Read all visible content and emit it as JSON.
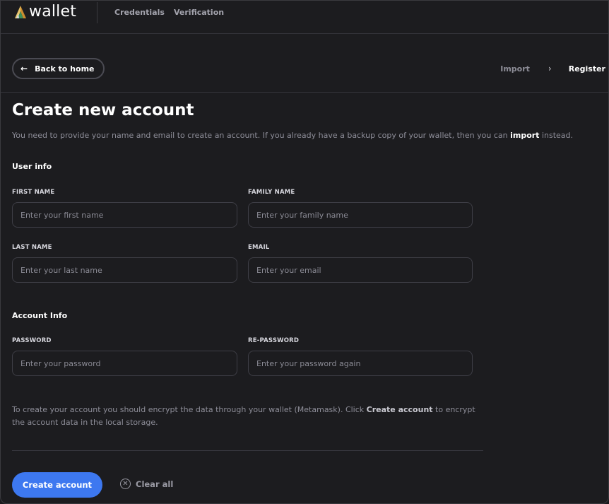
{
  "header": {
    "logo_text": "wallet",
    "nav": [
      {
        "label": "Credentials"
      },
      {
        "label": "Verification"
      }
    ]
  },
  "subbar": {
    "back_label": "Back to home",
    "steps": {
      "import": "Import",
      "register": "Register"
    }
  },
  "page": {
    "title": "Create new account",
    "intro_before": "You need to provide your name and email to create an account. If you already have a backup copy of your wallet, then you can ",
    "intro_link": "import",
    "intro_after": " instead."
  },
  "user_info": {
    "heading": "User info",
    "first_name": {
      "label": "FIRST NAME",
      "placeholder": "Enter your first name",
      "value": ""
    },
    "family_name": {
      "label": "FAMILY NAME",
      "placeholder": "Enter your family name",
      "value": ""
    },
    "last_name": {
      "label": "LAST NAME",
      "placeholder": "Enter your last name",
      "value": ""
    },
    "email": {
      "label": "EMAIL",
      "placeholder": "Enter your email",
      "value": ""
    }
  },
  "account_info": {
    "heading": "Account Info",
    "password": {
      "label": "PASSWORD",
      "placeholder": "Enter your password",
      "value": ""
    },
    "re_password": {
      "label": "RE-PASSWORD",
      "placeholder": "Enter your password again",
      "value": ""
    }
  },
  "note": {
    "before": "To create your account you should encrypt the data through your wallet (Metamask). Click ",
    "emphasis": "Create account",
    "after": " to encrypt the account data in the local storage."
  },
  "actions": {
    "create_label": "Create account",
    "clear_label": "Clear all"
  },
  "colors": {
    "background": "#1c1c1f",
    "accent": "#3d78f0",
    "muted_text": "#8e8e99",
    "border": "#3e3e46"
  },
  "icons": {
    "logo": "wallet-logo-icon",
    "back": "arrow-left-icon",
    "step_separator": "chevron-right-icon",
    "clear": "close-circle-icon"
  }
}
